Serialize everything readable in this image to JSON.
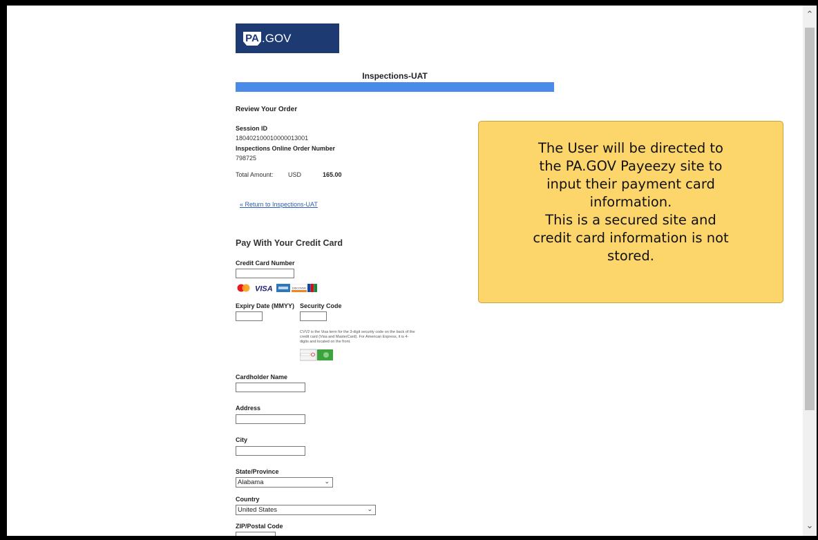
{
  "logo": {
    "pa": "PA",
    "gov": ".GOV"
  },
  "site_title": "Inspections-UAT",
  "review": {
    "heading": "Review Your Order",
    "session_id_label": "Session ID",
    "session_id_value": "180402100010000013001",
    "order_number_label": "Inspections Online Order Number",
    "order_number_value": "798725",
    "total_label": "Total Amount:",
    "currency": "USD",
    "total_value": "165.00",
    "return_link": "« Return to Inspections-UAT"
  },
  "payment": {
    "heading": "Pay With Your Credit Card",
    "card_number_label": "Credit Card Number",
    "expiry_label": "Expiry Date (MMYY)",
    "security_label": "Security Code",
    "cvv_help": "CVV2 is the Visa term for the 3-digit security code on the back of the credit card (Visa and MasterCard). For American Express, it is 4-digits and located on the front.",
    "cardholder_label": "Cardholder Name",
    "address_label": "Address",
    "city_label": "City",
    "state_label": "State/Province",
    "state_value": "Alabama",
    "country_label": "Country",
    "country_value": "United States",
    "zip_label": "ZIP/Postal Code"
  },
  "card_brands": {
    "visa": "VISA",
    "discover": "DISCOVER"
  },
  "callout": {
    "line1": "The User will be directed to",
    "line2": "the PA.GOV Payeezy site to",
    "line3": "input their payment card",
    "line4": "information.",
    "line5": "This is a secured site and",
    "line6": "credit card information is not",
    "line7": "stored."
  },
  "colors": {
    "brand_navy": "#1e3a73",
    "bar_blue": "#4a8ae8",
    "callout_yellow": "#fcd56b",
    "link_blue": "#2a5db0"
  }
}
